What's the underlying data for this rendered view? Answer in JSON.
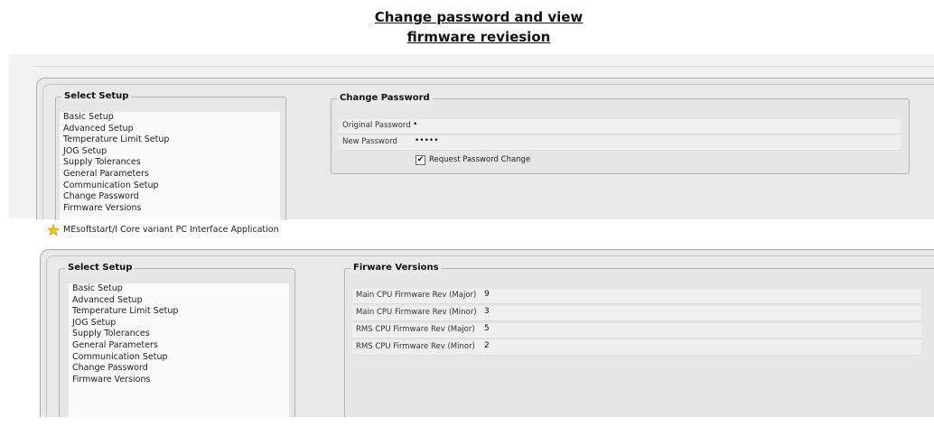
{
  "heading": {
    "line1": "Change password and view",
    "line2": "firmware reviesion"
  },
  "top_window": {
    "select_setup": {
      "title": "Select Setup",
      "items": [
        "Basic Setup",
        "Advanced Setup",
        "Temperature Limit Setup",
        "JOG Setup",
        "Supply Tolerances",
        "General Parameters",
        "Communication Setup",
        "Change Password",
        "Firmware Versions"
      ]
    },
    "change_password": {
      "title": "Change Password",
      "original_label": "Original Password",
      "original_value": "•",
      "new_label": "New Password",
      "new_value": "•••••",
      "request_change_label": "Request Password Change",
      "request_change_checked": true,
      "check_mark": "✔"
    }
  },
  "app_bar": {
    "title": "MEsoftstart/I Core variant PC Interface Application",
    "icon": "star-icon"
  },
  "bottom_window": {
    "select_setup": {
      "title": "Select Setup",
      "items": [
        "Basic Setup",
        "Advanced Setup",
        "Temperature Limit Setup",
        "JOG Setup",
        "Supply Tolerances",
        "General Parameters",
        "Communication Setup",
        "Change Password",
        "Firmware Versions"
      ]
    },
    "firmware": {
      "title": "Firware Versions",
      "rows": [
        {
          "label": "Main CPU Firmware Rev (Major)",
          "value": "9"
        },
        {
          "label": "Main CPU Firmware Rev (Minor)",
          "value": "3"
        },
        {
          "label": "RMS CPU Firmware Rev (Major)",
          "value": "5"
        },
        {
          "label": "RMS CPU Firmware Rev (Minor)",
          "value": "2"
        }
      ]
    }
  },
  "colors": {
    "window_bg": "#e9e9e9",
    "list_bg": "#fafafa",
    "star": "#f2c21a"
  }
}
